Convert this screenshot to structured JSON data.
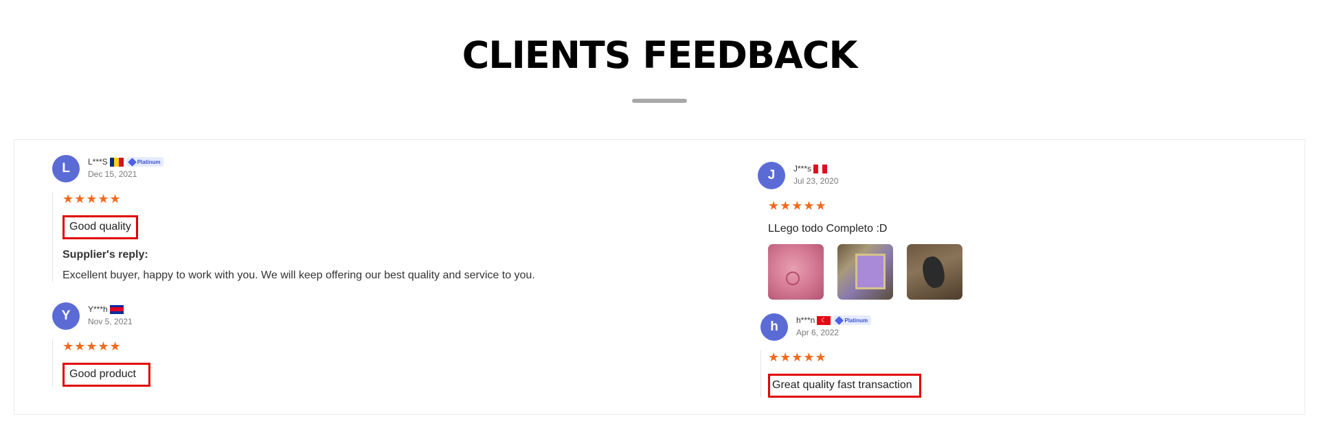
{
  "page": {
    "title": "CLIENTS FEEDBACK"
  },
  "stars_symbol": "★★★★★",
  "reviews": [
    {
      "initial": "L",
      "username": "L***S",
      "country_flag": [
        "#002B7F",
        "#FCD116",
        "#CE1126"
      ],
      "badge": "Platinum",
      "date": "Dec 15, 2021",
      "rating": 5,
      "comment": "Good quality",
      "reply_title": "Supplier's reply:",
      "reply_text": "Excellent buyer, happy to work with you. We will keep offering our best quality and service to you."
    },
    {
      "initial": "Y",
      "username": "Y***h",
      "country_flag": [
        "#032EA1",
        "#E00025",
        "#032EA1"
      ],
      "date": "Nov 5, 2021",
      "rating": 5,
      "comment": "Good product"
    },
    {
      "initial": "J",
      "username": "J***s",
      "country_flag": [
        "#D91023",
        "#FFFFFF",
        "#D91023"
      ],
      "date": "Jul 23, 2020",
      "rating": 5,
      "comment": "LLego todo Completo :D",
      "photos": [
        "pink-product-photo",
        "purple-frame-photo",
        "black-mouse-photo"
      ]
    },
    {
      "initial": "h",
      "username": "h***n",
      "country_flag": [
        "#E30A17"
      ],
      "badge": "Platinum",
      "date": "Apr 6, 2022",
      "rating": 5,
      "comment": "Great quality fast transaction"
    }
  ],
  "colors": {
    "avatar": "#5b6bd6",
    "stars": "#f06a1d",
    "highlight_box": "#e00000",
    "badge_bg": "#e6ebff"
  }
}
